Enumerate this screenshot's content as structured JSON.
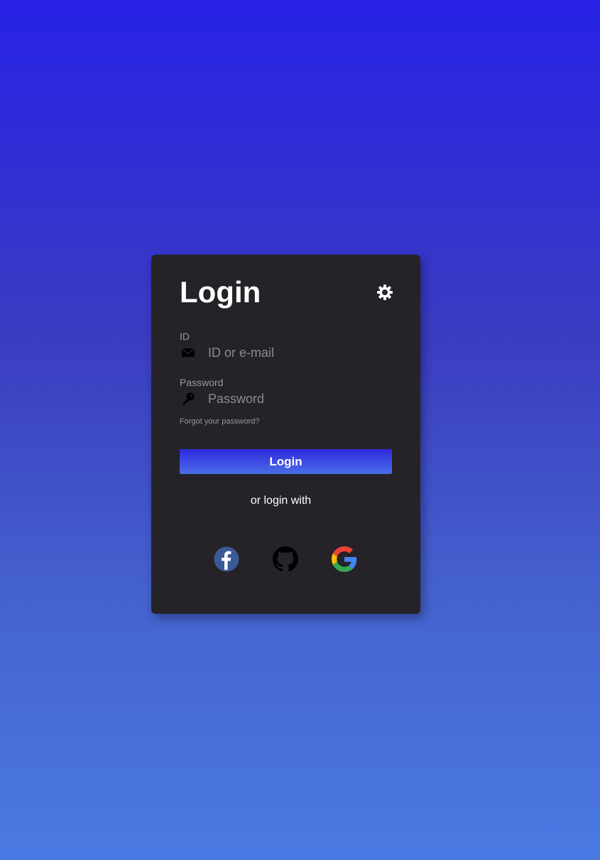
{
  "login": {
    "title": "Login",
    "id_label": "ID",
    "id_placeholder": "ID or e-mail",
    "password_label": "Password",
    "password_placeholder": "Password",
    "forgot_link": "Forgot your password?",
    "submit_label": "Login",
    "alt_login_text": "or login with"
  },
  "icons": {
    "theme": "gear-icon",
    "id_field": "envelope-icon",
    "password_field": "key-icon",
    "social": [
      "facebook-icon",
      "github-icon",
      "google-icon"
    ]
  },
  "colors": {
    "card_background": "#252328",
    "button_gradient_start": "#2f28df",
    "button_gradient_end": "#4a6ee8",
    "facebook": "#3b5998"
  }
}
